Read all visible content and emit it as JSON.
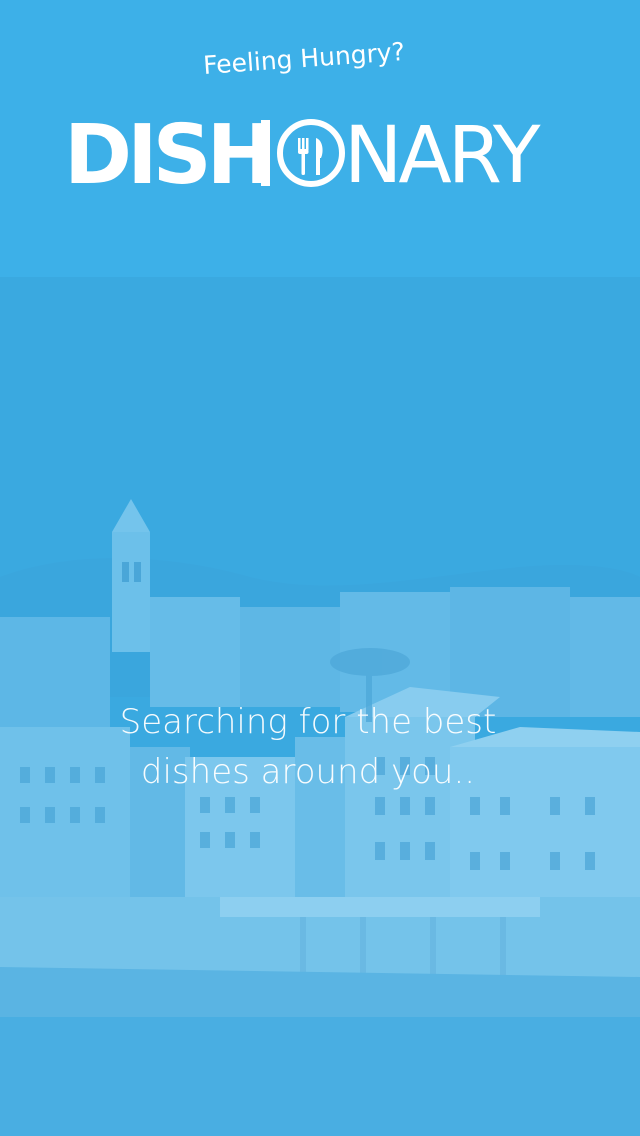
{
  "header": {
    "tagline": "Feeling Hungry?",
    "logo": {
      "bold_part": "DISH",
      "thin_part": "NARY",
      "icon": "fork-knife-icon"
    }
  },
  "main": {
    "status_line_1": "Searching for the best",
    "status_line_2": "dishes around you.."
  },
  "colors": {
    "header_bg": "#3db0e8",
    "overlay_blue": "#3aa9e0",
    "text": "#ffffff"
  }
}
